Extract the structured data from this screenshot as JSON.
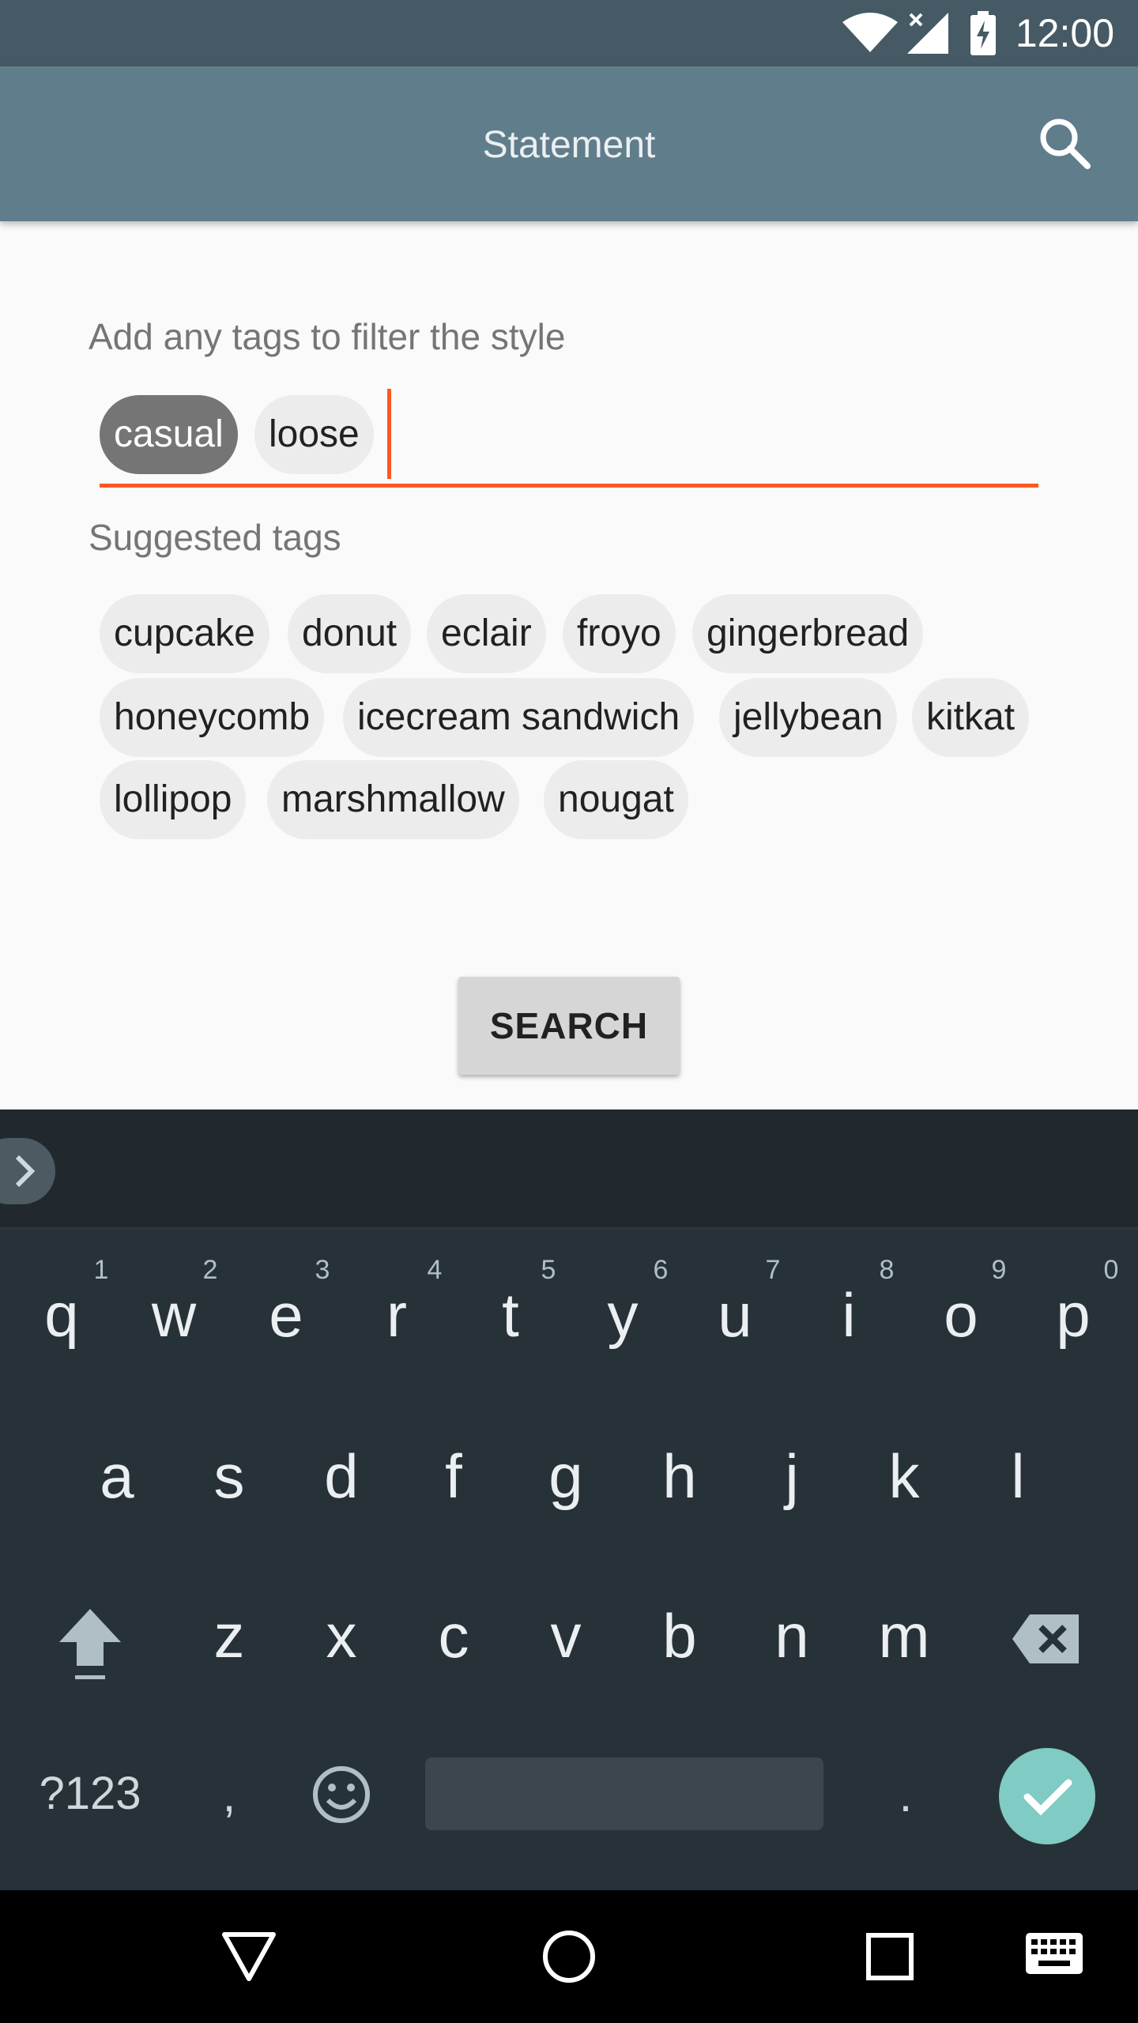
{
  "status_bar": {
    "time": "12:00",
    "icons": [
      "wifi-icon",
      "signal-icon",
      "battery-charging-icon"
    ]
  },
  "app_bar": {
    "title": "Statement",
    "search_icon": "search-icon"
  },
  "tags_input": {
    "label": "Add any tags to filter the style",
    "selected_tags": [
      {
        "label": "casual",
        "state": "highlighted"
      },
      {
        "label": "loose",
        "state": "normal"
      }
    ],
    "value": ""
  },
  "suggested": {
    "label": "Suggested tags",
    "tags": [
      "cupcake",
      "donut",
      "eclair",
      "froyo",
      "gingerbread",
      "honeycomb",
      "icecream sandwich",
      "jellybean",
      "kitkat",
      "lollipop",
      "marshmallow",
      "nougat"
    ]
  },
  "search_button": "SEARCH",
  "keyboard": {
    "row1": [
      "q",
      "w",
      "e",
      "r",
      "t",
      "y",
      "u",
      "i",
      "o",
      "p"
    ],
    "row1_hints": [
      "1",
      "2",
      "3",
      "4",
      "5",
      "6",
      "7",
      "8",
      "9",
      "0"
    ],
    "row2": [
      "a",
      "s",
      "d",
      "f",
      "g",
      "h",
      "j",
      "k",
      "l"
    ],
    "row3": [
      "z",
      "x",
      "c",
      "v",
      "b",
      "n",
      "m"
    ],
    "symbols_key": "?123",
    "comma_key": ",",
    "period_key": ".",
    "accent_color": "#80cbc4"
  },
  "nav_bar": {
    "icons": [
      "back-icon",
      "home-icon",
      "recents-icon",
      "keyboard-switch-icon"
    ]
  },
  "colors": {
    "status_bar": "#455a64",
    "app_bar": "#607d8b",
    "accent": "#ff5722",
    "keyboard_bg": "#263238"
  }
}
